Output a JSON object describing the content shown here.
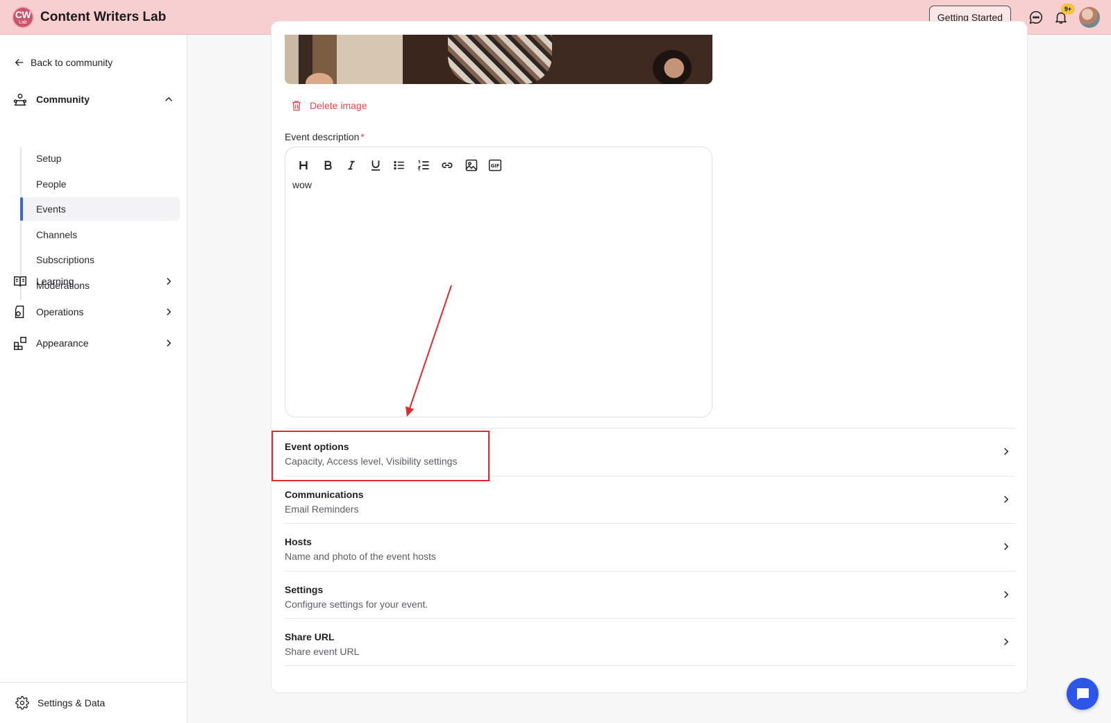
{
  "header": {
    "logo_line1": "CW",
    "logo_line2": "Lab",
    "brand": "Content Writers Lab",
    "getting_started": "Getting Started",
    "notification_badge": "9+"
  },
  "sidebar": {
    "back_label": "Back to community",
    "groups": [
      {
        "label": "Community",
        "icon": "community-icon",
        "expanded": true
      },
      {
        "label": "Learning",
        "icon": "book-icon",
        "expanded": false
      },
      {
        "label": "Operations",
        "icon": "operations-icon",
        "expanded": false
      },
      {
        "label": "Appearance",
        "icon": "appearance-icon",
        "expanded": false
      }
    ],
    "community_items": [
      "Setup",
      "People",
      "Events",
      "Channels",
      "Subscriptions",
      "Moderations"
    ],
    "active_item": "Events",
    "footer_label": "Settings & Data"
  },
  "form": {
    "delete_image": "Delete image",
    "description_label": "Event description",
    "required_mark": "*",
    "description_text": "wow",
    "toolbar_icons": [
      "heading-icon",
      "bold-icon",
      "italic-icon",
      "underline-icon",
      "bullet-list-icon",
      "numbered-list-icon",
      "link-icon",
      "image-icon",
      "gif-icon"
    ]
  },
  "sections": [
    {
      "title": "Event options",
      "subtitle": "Capacity, Access level, Visibility settings"
    },
    {
      "title": "Communications",
      "subtitle": "Email Reminders"
    },
    {
      "title": "Hosts",
      "subtitle": "Name and photo of the event hosts"
    },
    {
      "title": "Settings",
      "subtitle": "Configure settings for your event."
    },
    {
      "title": "Share URL",
      "subtitle": "Share event URL"
    }
  ],
  "colors": {
    "header_bg": "#f7cfd1",
    "accent": "#3f63e8",
    "danger": "#e5484d",
    "annotation": "#e0282e",
    "fab": "#2b56e8"
  }
}
